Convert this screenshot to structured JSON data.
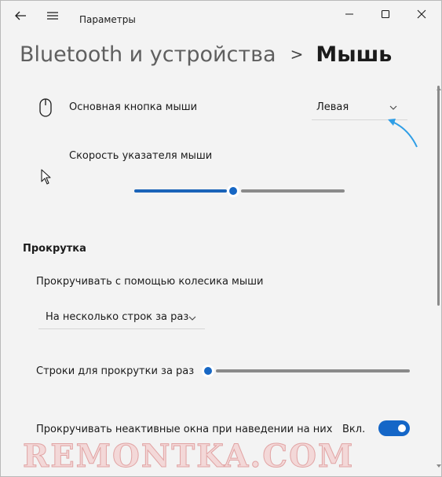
{
  "window": {
    "title": "Параметры"
  },
  "breadcrumb": {
    "parent": "Bluetooth и устройства",
    "separator": ">",
    "current": "Мышь"
  },
  "mouse": {
    "primary_button": {
      "label": "Основная кнопка мыши",
      "value": "Левая"
    },
    "pointer_speed": {
      "label": "Скорость указателя мыши",
      "value_fraction": 0.47
    }
  },
  "scrolling": {
    "heading": "Прокрутка",
    "wheel": {
      "label": "Прокручивать с помощью колесика мыши",
      "value": "На несколько строк за раз"
    },
    "lines": {
      "label": "Строки для прокрутки за раз",
      "value_fraction": 0.03
    },
    "inactive": {
      "label": "Прокручивать неактивные окна при наведении на них",
      "state_label": "Вкл.",
      "on": true
    }
  },
  "watermark": "REMONTKA.COM",
  "colors": {
    "accent": "#1767c4",
    "background": "#f3f3f3",
    "arrow": "#2f9ee6"
  }
}
